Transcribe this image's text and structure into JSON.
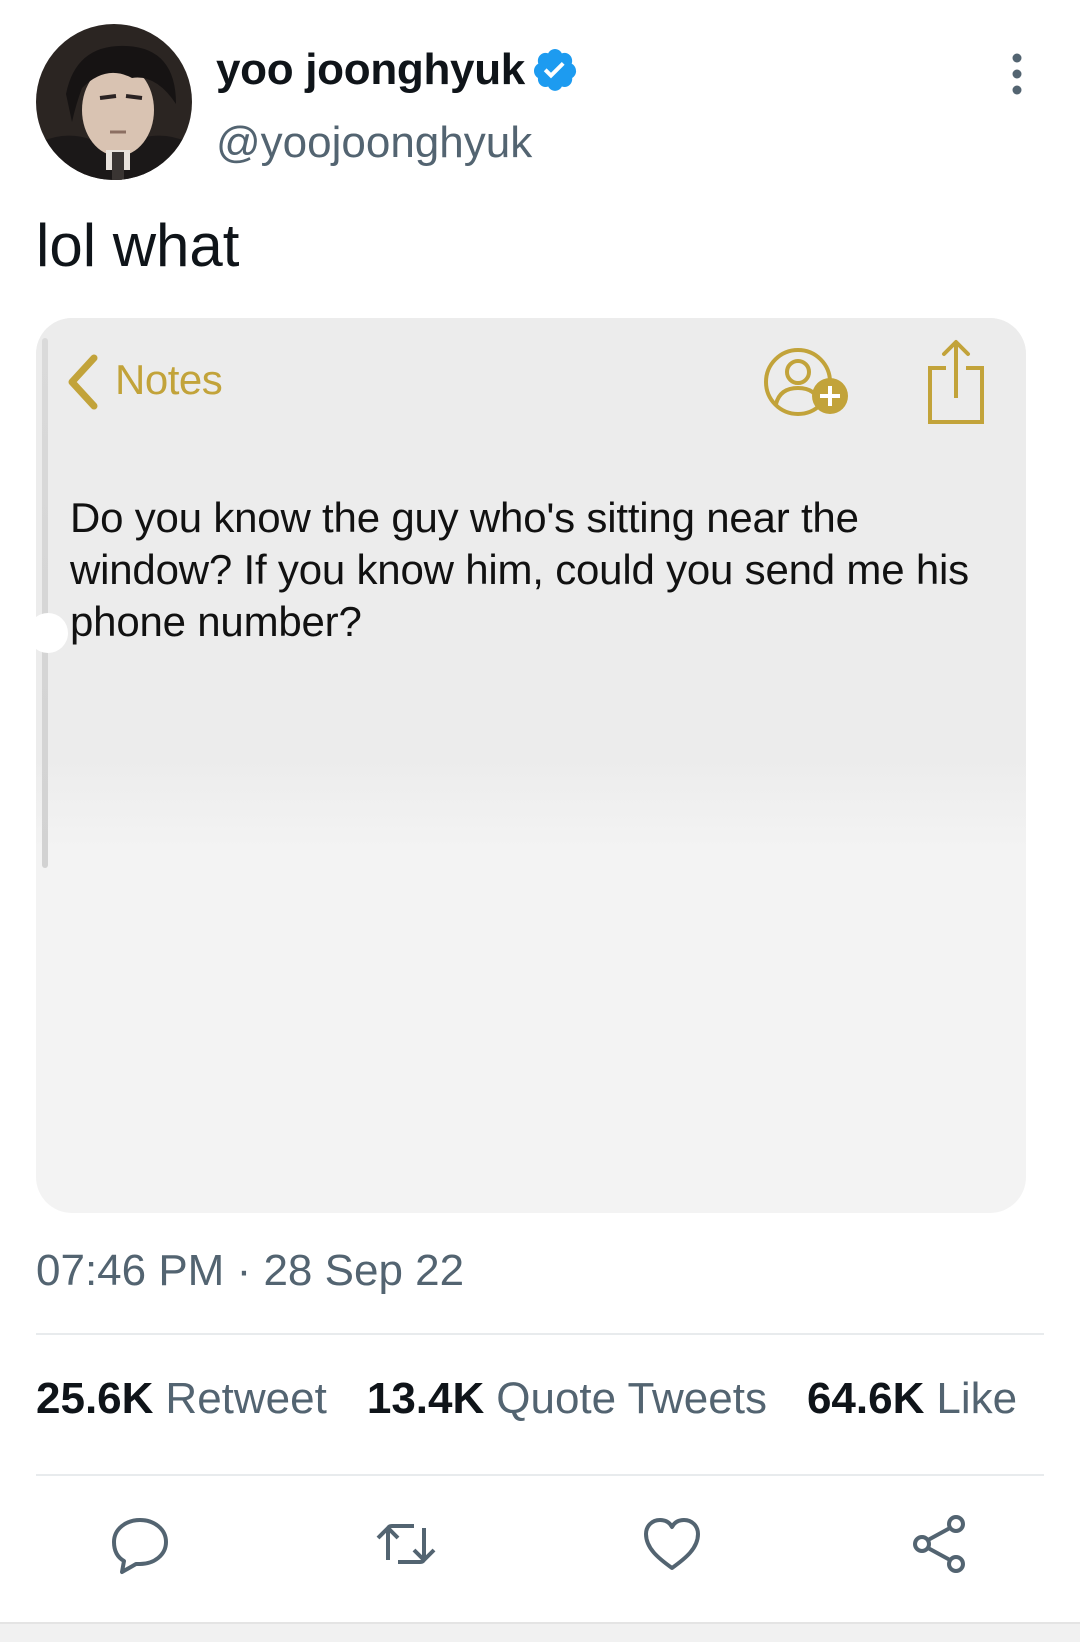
{
  "tweet": {
    "display_name": "yoo joonghyuk",
    "handle": "@yoojoonghyuk",
    "verified": true,
    "text": "lol what",
    "time": "07:46 PM",
    "separator": " · ",
    "date": "28 Sep 22",
    "avatar_icon": "avatar-image",
    "more_icon": "more-vertical-icon"
  },
  "media": {
    "back_label": "Notes",
    "note_text": "Do you know the guy who's sitting near the window? If you know him, could you send me his phone number?",
    "accent_color": "#c2a33a",
    "icons": [
      "chevron-left-icon",
      "add-person-icon",
      "share-icon"
    ]
  },
  "stats": [
    {
      "count": "25.6K",
      "label": "Retweet"
    },
    {
      "count": "13.4K",
      "label": "Quote Tweets"
    },
    {
      "count": "64.6K",
      "label": "Like"
    }
  ],
  "actions": [
    "reply-icon",
    "retweet-icon",
    "like-icon",
    "share-icon"
  ],
  "colors": {
    "verified": "#1d9bf0",
    "secondary_text": "#536471",
    "divider": "#e8ebed"
  }
}
